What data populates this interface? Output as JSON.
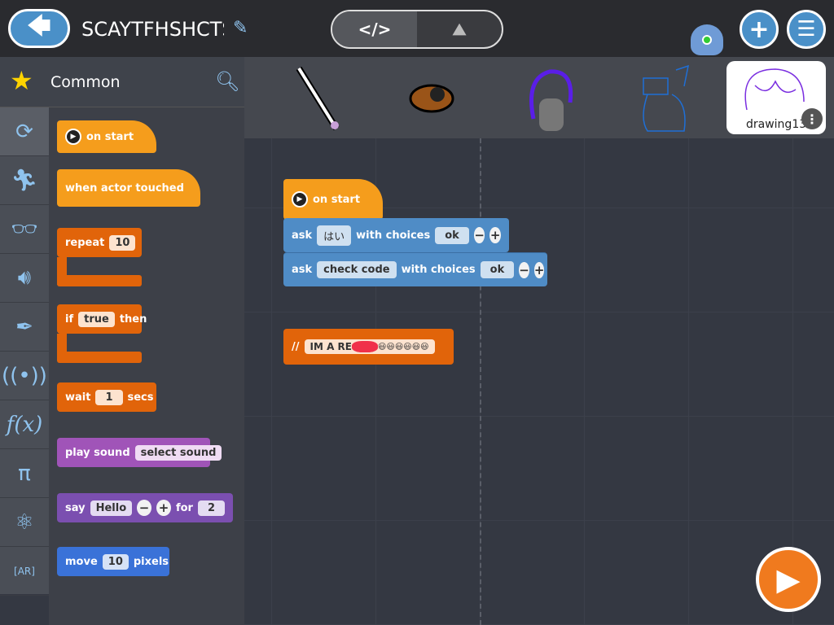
{
  "header": {
    "project_title": "SCAYTFHSHCTS",
    "code_view_icon": "</>",
    "scene_view_icon": "image-icon"
  },
  "sprites": {
    "selected_name": "drawing13"
  },
  "palette": {
    "category_title": "Common",
    "categories": [
      "loop",
      "motion",
      "looks",
      "sound",
      "pen",
      "events",
      "functions",
      "math",
      "science",
      "ar"
    ],
    "blocks": {
      "on_start": "on start",
      "when_touched": "when actor touched",
      "repeat": "repeat",
      "repeat_val": "10",
      "if": "if",
      "if_val": "true",
      "then": "then",
      "wait": "wait",
      "wait_val": "1",
      "secs": "secs",
      "play_sound": "play sound",
      "sound_val": "select sound",
      "say": "say",
      "say_val": "Hello",
      "for": "for",
      "say_secs": "2",
      "move": "move",
      "move_val": "10",
      "pixels": "pixels"
    }
  },
  "workspace": {
    "on_start": "on start",
    "ask1": {
      "label": "ask",
      "question": "はい",
      "with": "with choices",
      "choice": "ok"
    },
    "ask2": {
      "label": "ask",
      "question": "check code",
      "with": "with choices",
      "choice": "ok"
    },
    "comment": {
      "prefix": "//",
      "text": "IM A RE",
      "emoji": "😃😃😃😃😃😃"
    }
  },
  "colors": {
    "event": "#f59d1c",
    "loop": "#e1640a",
    "sound": "#a054b8",
    "looks": "#7b4fb0",
    "motion": "#3a72d8",
    "ask": "#4f8cc6",
    "run": "#f07a1e"
  }
}
